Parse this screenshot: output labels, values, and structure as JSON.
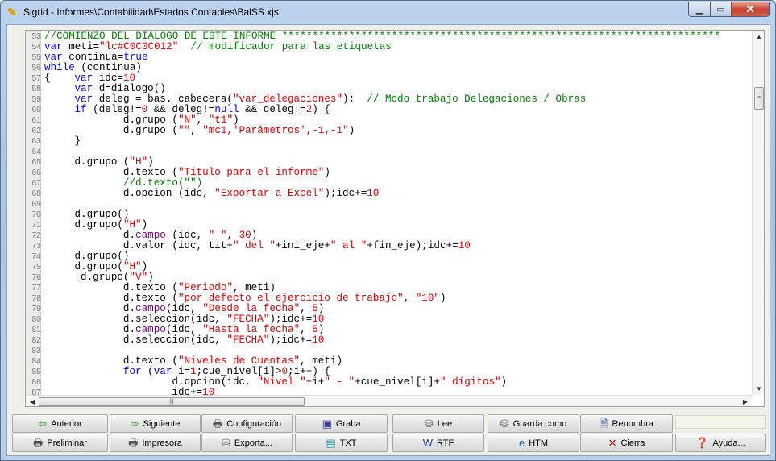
{
  "window": {
    "title": "Sigrid - Informes\\Contabilidad\\Estados Contables\\BalSS.xjs"
  },
  "editor": {
    "first_line": 53,
    "lines": [
      [
        [
          "c",
          "//COMIENZO DEL DIALOGO DE ESTE INFORME ************************************************************************"
        ]
      ],
      [
        [
          "k",
          "var"
        ],
        [
          "p",
          " meti="
        ],
        [
          "s",
          "\"lc#C0C0C012\""
        ],
        [
          "p",
          "  "
        ],
        [
          "c",
          "// modificador para las etiquetas"
        ]
      ],
      [
        [
          "k",
          "var"
        ],
        [
          "p",
          " continua="
        ],
        [
          "k",
          "true"
        ]
      ],
      [
        [
          "k",
          "while"
        ],
        [
          "p",
          " (continua)"
        ]
      ],
      [
        [
          "p",
          "{\t"
        ],
        [
          "k",
          "var"
        ],
        [
          "p",
          " idc="
        ],
        [
          "n",
          "10"
        ]
      ],
      [
        [
          "p",
          "\t"
        ],
        [
          "k",
          "var"
        ],
        [
          "p",
          " d=dialogo()"
        ]
      ],
      [
        [
          "p",
          "\t"
        ],
        [
          "k",
          "var"
        ],
        [
          "p",
          " deleg = bas. cabecera("
        ],
        [
          "s",
          "\"var_delegaciones\""
        ],
        [
          "p",
          ");  "
        ],
        [
          "c",
          "// Modo trabajo Delegaciones / Obras"
        ]
      ],
      [
        [
          "p",
          "\t"
        ],
        [
          "k",
          "if"
        ],
        [
          "p",
          " (deleg!="
        ],
        [
          "n",
          "0"
        ],
        [
          "p",
          " && deleg!="
        ],
        [
          "k",
          "null"
        ],
        [
          "p",
          " && deleg!="
        ],
        [
          "n",
          "2"
        ],
        [
          "p",
          ") {"
        ]
      ],
      [
        [
          "p",
          "\t\td.grupo ("
        ],
        [
          "s",
          "\"N\""
        ],
        [
          "p",
          ", "
        ],
        [
          "s",
          "\"t1\""
        ],
        [
          "p",
          ")"
        ]
      ],
      [
        [
          "p",
          "\t\td.grupo ("
        ],
        [
          "s",
          "\"\""
        ],
        [
          "p",
          ", "
        ],
        [
          "s",
          "\"mc1,'Parámetros',-1,-1\""
        ],
        [
          "p",
          ")"
        ]
      ],
      [
        [
          "p",
          "\t}"
        ]
      ],
      [],
      [
        [
          "p",
          "\td.grupo ("
        ],
        [
          "s",
          "\"H\""
        ],
        [
          "p",
          ")"
        ]
      ],
      [
        [
          "p",
          "\t\td.texto ("
        ],
        [
          "s",
          "\"Título para el informe\""
        ],
        [
          "p",
          ")"
        ]
      ],
      [
        [
          "p",
          "\t\t"
        ],
        [
          "c",
          "//d.texto(\"\")"
        ]
      ],
      [
        [
          "p",
          "\t\td.opcion (idc, "
        ],
        [
          "s",
          "\"Exportar a Excel\""
        ],
        [
          "p",
          ");idc+="
        ],
        [
          "n",
          "10"
        ]
      ],
      [],
      [
        [
          "p",
          "\td.grupo()"
        ]
      ],
      [
        [
          "p",
          "\td.grupo("
        ],
        [
          "s",
          "\"H\""
        ],
        [
          "p",
          ")"
        ]
      ],
      [
        [
          "p",
          "\t\td."
        ],
        [
          "f",
          "campo"
        ],
        [
          "p",
          " (idc, "
        ],
        [
          "s",
          "\" \""
        ],
        [
          "p",
          ", "
        ],
        [
          "n",
          "30"
        ],
        [
          "p",
          ")"
        ]
      ],
      [
        [
          "p",
          "\t\td.valor (idc, tit+"
        ],
        [
          "s",
          "\" del \""
        ],
        [
          "p",
          "+ini_eje+"
        ],
        [
          "s",
          "\" al \""
        ],
        [
          "p",
          "+fin_eje);idc+="
        ],
        [
          "n",
          "10"
        ]
      ],
      [
        [
          "p",
          "\td.grupo()"
        ]
      ],
      [
        [
          "p",
          "\td.grupo("
        ],
        [
          "s",
          "\"H\""
        ],
        [
          "p",
          ")"
        ]
      ],
      [
        [
          "p",
          "\t d.grupo("
        ],
        [
          "s",
          "\"V\""
        ],
        [
          "p",
          ")"
        ]
      ],
      [
        [
          "p",
          "\t\td.texto ("
        ],
        [
          "s",
          "\"Periodo\""
        ],
        [
          "p",
          ", meti)"
        ]
      ],
      [
        [
          "p",
          "\t\td.texto ("
        ],
        [
          "s",
          "\"por defecto el ejercicio de trabajo\""
        ],
        [
          "p",
          ", "
        ],
        [
          "s",
          "\"10\""
        ],
        [
          "p",
          ")"
        ]
      ],
      [
        [
          "p",
          "\t\td."
        ],
        [
          "f",
          "campo"
        ],
        [
          "p",
          "(idc, "
        ],
        [
          "s",
          "\"Desde la fecha\""
        ],
        [
          "p",
          ", "
        ],
        [
          "n",
          "5"
        ],
        [
          "p",
          ")"
        ]
      ],
      [
        [
          "p",
          "\t\td.seleccion(idc, "
        ],
        [
          "s",
          "\"FECHA\""
        ],
        [
          "p",
          ");idc+="
        ],
        [
          "n",
          "10"
        ]
      ],
      [
        [
          "p",
          "\t\td."
        ],
        [
          "f",
          "campo"
        ],
        [
          "p",
          "(idc, "
        ],
        [
          "s",
          "\"Hasta la fecha\""
        ],
        [
          "p",
          ", "
        ],
        [
          "n",
          "5"
        ],
        [
          "p",
          ")"
        ]
      ],
      [
        [
          "p",
          "\t\td.seleccion(idc, "
        ],
        [
          "s",
          "\"FECHA\""
        ],
        [
          "p",
          ");idc+="
        ],
        [
          "n",
          "10"
        ]
      ],
      [],
      [
        [
          "p",
          "\t\td.texto ("
        ],
        [
          "s",
          "\"Niveles de Cuentas\""
        ],
        [
          "p",
          ", meti)"
        ]
      ],
      [
        [
          "p",
          "\t\t"
        ],
        [
          "k",
          "for"
        ],
        [
          "p",
          " ("
        ],
        [
          "k",
          "var"
        ],
        [
          "p",
          " i="
        ],
        [
          "n",
          "1"
        ],
        [
          "p",
          ";cue_nivel[i]>"
        ],
        [
          "n",
          "0"
        ],
        [
          "p",
          ";i++) {"
        ]
      ],
      [
        [
          "p",
          "\t\t\td.opcion(idc, "
        ],
        [
          "s",
          "\"Nivel \""
        ],
        [
          "p",
          "+i+"
        ],
        [
          "s",
          "\" - \""
        ],
        [
          "p",
          "+cue_nivel[i]+"
        ],
        [
          "s",
          "\" dígitos\""
        ],
        [
          "p",
          ")"
        ]
      ],
      [
        [
          "p",
          "\t\t\tidc+="
        ],
        [
          "n",
          "10"
        ]
      ]
    ]
  },
  "buttons": {
    "row1": [
      {
        "label": "Anterior",
        "icon": "arrow-left-icon",
        "glyph": "⇦",
        "color": "#2e8b2e"
      },
      {
        "label": "Siguiente",
        "icon": "arrow-right-icon",
        "glyph": "⇨",
        "color": "#2e8b2e"
      },
      {
        "label": "Configuración",
        "icon": "printer-config-icon",
        "glyph": "🖶",
        "color": "#555"
      },
      {
        "label": "Graba",
        "icon": "floppy-disk-icon",
        "glyph": "▣",
        "color": "#3a3aa0"
      },
      {
        "label": "Lee",
        "icon": "disk-read-icon",
        "glyph": "⛁",
        "color": "#666"
      },
      {
        "label": "Guarda como",
        "icon": "disk-save-as-icon",
        "glyph": "⛁",
        "color": "#666"
      },
      {
        "label": "Renombra",
        "icon": "rename-document-icon",
        "glyph": "🗎",
        "color": "#3a5aa0"
      }
    ],
    "row2": [
      {
        "label": "Preliminar",
        "icon": "print-preview-icon",
        "glyph": "🖶",
        "color": "#555"
      },
      {
        "label": "Impresora",
        "icon": "printer-icon",
        "glyph": "🖶",
        "color": "#555"
      },
      {
        "label": "Exporta...",
        "icon": "export-icon",
        "glyph": "⛁",
        "color": "#666"
      },
      {
        "label": "TXT",
        "icon": "txt-file-icon",
        "glyph": "▤",
        "color": "#1a9aa0"
      },
      {
        "label": "RTF",
        "icon": "word-document-icon",
        "glyph": "W",
        "color": "#1a3aa0"
      },
      {
        "label": "HTM",
        "icon": "internet-explorer-icon",
        "glyph": "e",
        "color": "#1a70d0"
      },
      {
        "label": "Cierra",
        "icon": "close-x-icon",
        "glyph": "✕",
        "color": "#d01010"
      },
      {
        "label": "Ayuda...",
        "icon": "help-icon",
        "glyph": "❓",
        "color": "#3a5ad0"
      }
    ]
  }
}
